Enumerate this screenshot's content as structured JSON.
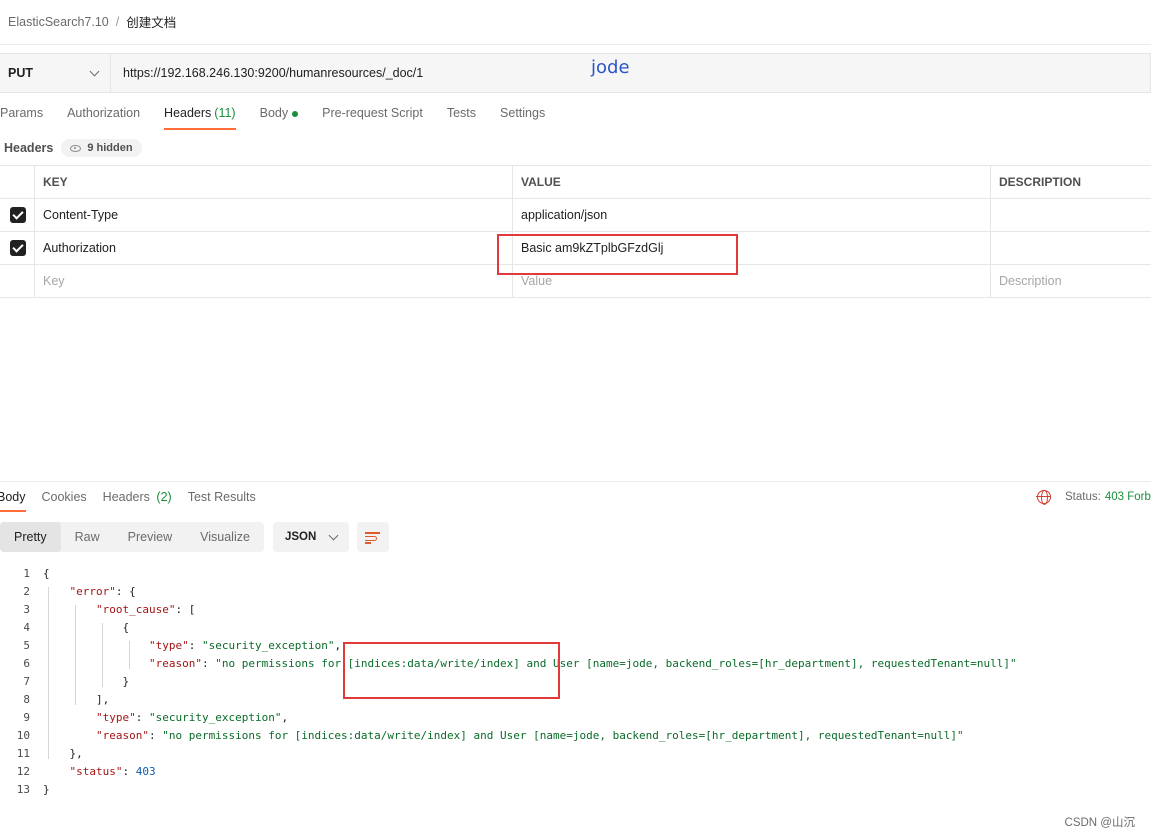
{
  "breadcrumb": {
    "parent": "ElasticSearch7.10",
    "separator": "/",
    "current": "创建文档"
  },
  "request": {
    "method": "PUT",
    "url": "https://192.168.246.130:9200/humanresources/_doc/1"
  },
  "annotation": "jode",
  "request_tabs": [
    {
      "label": "Params"
    },
    {
      "label": "Authorization"
    },
    {
      "label": "Headers",
      "count": "(11)",
      "active": true
    },
    {
      "label": "Body",
      "dot": true
    },
    {
      "label": "Pre-request Script"
    },
    {
      "label": "Tests"
    },
    {
      "label": "Settings"
    }
  ],
  "headers_section": {
    "title": "Headers",
    "hidden_label": "9 hidden"
  },
  "headers_table": {
    "columns": [
      "KEY",
      "VALUE",
      "DESCRIPTION"
    ],
    "rows": [
      {
        "checked": true,
        "key": "Content-Type",
        "value": "application/json",
        "description": ""
      },
      {
        "checked": true,
        "key": "Authorization",
        "value": "Basic am9kZTplbGFzdGlj",
        "description": ""
      }
    ],
    "placeholder": {
      "key": "Key",
      "value": "Value",
      "description": "Description"
    }
  },
  "response_tabs": [
    {
      "label": "Body",
      "active": true
    },
    {
      "label": "Cookies"
    },
    {
      "label": "Headers",
      "count": "(2)"
    },
    {
      "label": "Test Results"
    }
  ],
  "status": {
    "label": "Status:",
    "code": "403 Forb"
  },
  "view_modes": [
    "Pretty",
    "Raw",
    "Preview",
    "Visualize"
  ],
  "active_view": "Pretty",
  "format": "JSON",
  "code_lines": [
    {
      "n": "1",
      "text": "{"
    },
    {
      "n": "2",
      "text": "    \"error\": {"
    },
    {
      "n": "3",
      "text": "        \"root_cause\": ["
    },
    {
      "n": "4",
      "text": "            {"
    },
    {
      "n": "5",
      "text": "                \"type\": \"security_exception\","
    },
    {
      "n": "6",
      "text": "                \"reason\": \"no permissions for [indices:data/write/index] and User [name=jode, backend_roles=[hr_department], requestedTenant=null]\""
    },
    {
      "n": "7",
      "text": "            }"
    },
    {
      "n": "8",
      "text": "        ],"
    },
    {
      "n": "9",
      "text": "        \"type\": \"security_exception\","
    },
    {
      "n": "10",
      "text": "        \"reason\": \"no permissions for [indices:data/write/index] and User [name=jode, backend_roles=[hr_department], requestedTenant=null]\""
    },
    {
      "n": "11",
      "text": "    },"
    },
    {
      "n": "12",
      "text": "    \"status\": 403"
    },
    {
      "n": "13",
      "text": "}"
    }
  ],
  "colors": {
    "accent": "#ff6c37",
    "success": "#1a8e3c",
    "error": "#d23f31",
    "highlight_box": "#e03a3a",
    "annotation": "#2a56c6"
  },
  "watermark": "CSDN @山沉"
}
